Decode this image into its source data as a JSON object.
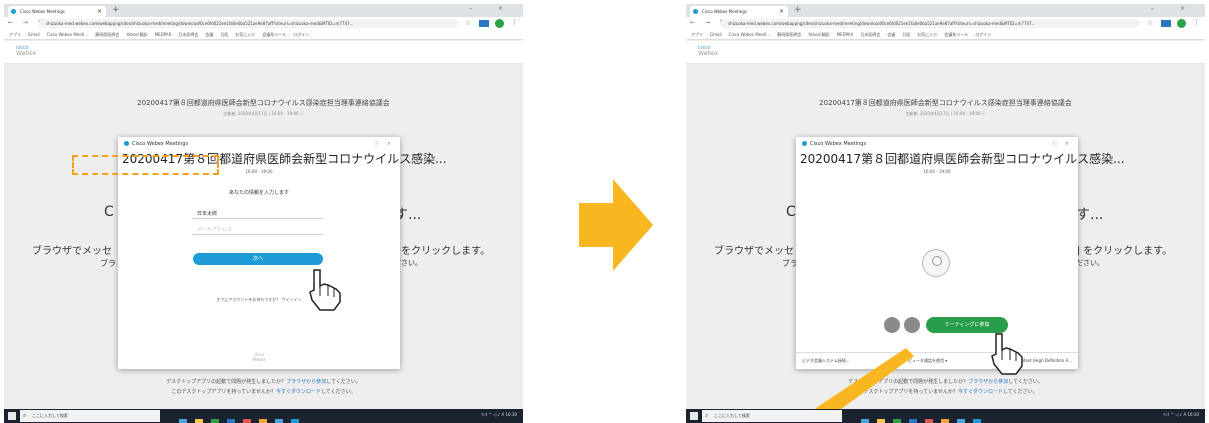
{
  "browser": {
    "tab_title": "Cisco Webex Meetings",
    "tab_close": "×",
    "new_tab": "+",
    "window_controls": "– ×",
    "nav_glyphs": "← → C",
    "url": "shizuoka-med.webex.com/webappng/sites/shizuoka-med/meeting/download/0ce6fd021ee1fa0e0ba521ae9e87aff?siteurl=shizuoka-med&MTID=m7747...",
    "bookmarks": [
      "アプリ",
      "Gmail",
      "Cisco Webex Meeti...",
      "静岡県医師会",
      "Yahoo!翻訳",
      "MEDPAX",
      "日本医師会",
      "会議",
      "日医",
      "お気に入り",
      "会議系ツール",
      "ログイン"
    ]
  },
  "webex_logo": {
    "top": "cisco",
    "bottom": "Webex"
  },
  "meeting": {
    "title": "20200417第８回都道府県医師会新型コロナウイルス感染症担当理事連絡協議会",
    "date": "主催者: 2020年4月17日 | 16:00 - 19:00 ⓘ"
  },
  "background_text": {
    "c": "C",
    "su": "す...",
    "browser_left": "ブラウザでメッセ",
    "browser_right": "] をクリックします。",
    "left2": "ブラ",
    "right2": "ださい。",
    "bottom_line1_a": "デスクトップアプリの起動で問題が発生しましたか？",
    "bottom_line1_link": "ブラウザから参加",
    "bottom_line1_b": "してください。",
    "bottom_line2_a": "このデスクトップアプリを持っていませんか？",
    "bottom_line2_link": "今すぐダウンロード",
    "bottom_line2_b": "してください。"
  },
  "dialog_left": {
    "app_name": "Cisco Webex Meetings",
    "controls": "ⓘ ×",
    "title": "20200417第８回都道府県医師会新型コロナウイルス感染...",
    "time": "16:00 - 19:00",
    "prompt": "あなたの情報を入力します",
    "name_value": "日本太郎",
    "email_placeholder": "メールアドレス",
    "next_label": "次へ",
    "signin_text": "すでにアカウントをお持ちですか？ サインイン",
    "footer_top": "cisco",
    "footer_bottom": "Webex"
  },
  "dialog_right": {
    "app_name": "Cisco Webex Meetings",
    "controls": "ⓘ ×",
    "title": "20200417第８回都道府県医師会新型コロナウイルス感染...",
    "time": "16:00 - 19:00",
    "join_label": "ミーティングに参加",
    "bottom_left": "ビデオ会議システム接続...",
    "bottom_mid": "コンピュータ通話を使用 ▾",
    "bottom_right": "Headset (High Definition A..."
  },
  "taskbar": {
    "search_placeholder": "ここに入力して検索",
    "tray_text": "ﾘﾝｸ ^ ◁ ♪ A 16:30"
  },
  "colors": {
    "arrow": "#f8b720",
    "highlight": "#f5a11c",
    "webex_blue": "#1d9bd7",
    "join_green": "#2a9d4a"
  }
}
